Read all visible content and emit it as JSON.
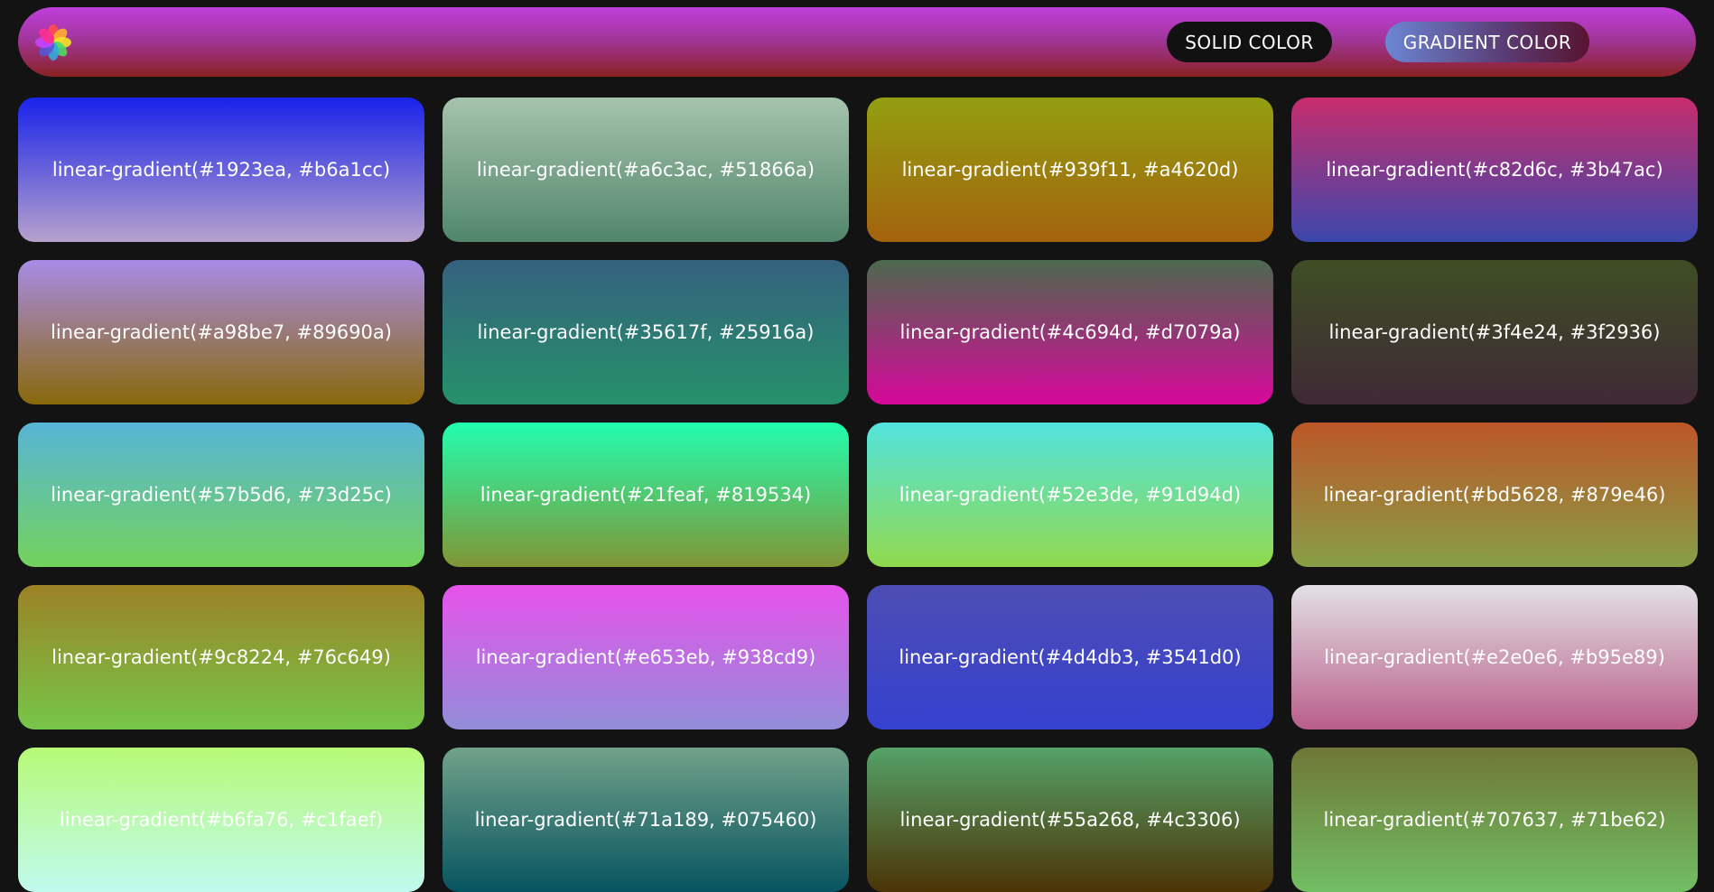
{
  "navbar": {
    "logo_icon": "color-palette-icon",
    "solid_label": "SOLID COLOR",
    "gradient_label": "GRADIENT COLOR"
  },
  "cards": [
    {
      "label": "linear-gradient(#1923ea, #b6a1cc)",
      "from": "#1923ea",
      "to": "#b6a1cc"
    },
    {
      "label": "linear-gradient(#a6c3ac, #51866a)",
      "from": "#a6c3ac",
      "to": "#51866a"
    },
    {
      "label": "linear-gradient(#939f11, #a4620d)",
      "from": "#939f11",
      "to": "#a4620d"
    },
    {
      "label": "linear-gradient(#c82d6c, #3b47ac)",
      "from": "#c82d6c",
      "to": "#3b47ac"
    },
    {
      "label": "linear-gradient(#a98be7, #89690a)",
      "from": "#a98be7",
      "to": "#89690a"
    },
    {
      "label": "linear-gradient(#35617f, #25916a)",
      "from": "#35617f",
      "to": "#25916a"
    },
    {
      "label": "linear-gradient(#4c694d, #d7079a)",
      "from": "#4c694d",
      "to": "#d7079a"
    },
    {
      "label": "linear-gradient(#3f4e24, #3f2936)",
      "from": "#3f4e24",
      "to": "#3f2936"
    },
    {
      "label": "linear-gradient(#57b5d6, #73d25c)",
      "from": "#57b5d6",
      "to": "#73d25c"
    },
    {
      "label": "linear-gradient(#21feaf, #819534)",
      "from": "#21feaf",
      "to": "#819534"
    },
    {
      "label": "linear-gradient(#52e3de, #91d94d)",
      "from": "#52e3de",
      "to": "#91d94d"
    },
    {
      "label": "linear-gradient(#bd5628, #879e46)",
      "from": "#bd5628",
      "to": "#879e46"
    },
    {
      "label": "linear-gradient(#9c8224, #76c649)",
      "from": "#9c8224",
      "to": "#76c649"
    },
    {
      "label": "linear-gradient(#e653eb, #938cd9)",
      "from": "#e653eb",
      "to": "#938cd9"
    },
    {
      "label": "linear-gradient(#4d4db3, #3541d0)",
      "from": "#4d4db3",
      "to": "#3541d0"
    },
    {
      "label": "linear-gradient(#e2e0e6, #b95e89)",
      "from": "#e2e0e6",
      "to": "#b95e89"
    },
    {
      "label": "linear-gradient(#b6fa76, #c1faef)",
      "from": "#b6fa76",
      "to": "#c1faef"
    },
    {
      "label": "linear-gradient(#71a189, #075460)",
      "from": "#71a189",
      "to": "#075460"
    },
    {
      "label": "linear-gradient(#55a268, #4c3306)",
      "from": "#55a268",
      "to": "#4c3306"
    },
    {
      "label": "linear-gradient(#707637, #71be62)",
      "from": "#707637",
      "to": "#71be62"
    }
  ]
}
